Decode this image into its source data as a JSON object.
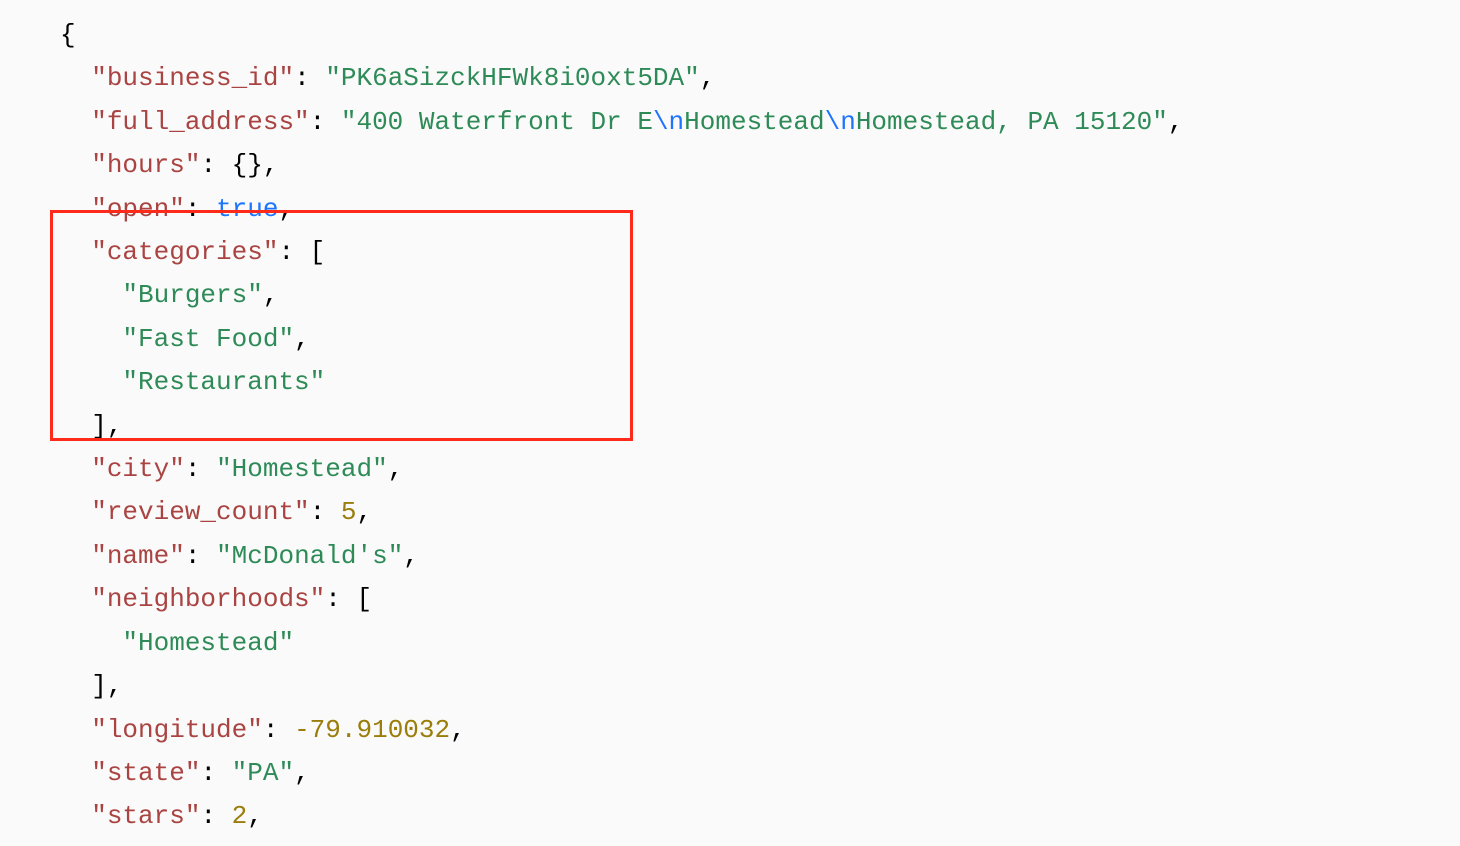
{
  "keys": {
    "business_id": "\"business_id\"",
    "full_address": "\"full_address\"",
    "hours": "\"hours\"",
    "open": "\"open\"",
    "categories": "\"categories\"",
    "city": "\"city\"",
    "review_count": "\"review_count\"",
    "name": "\"name\"",
    "neighborhoods": "\"neighborhoods\"",
    "longitude": "\"longitude\"",
    "state": "\"state\"",
    "stars": "\"stars\""
  },
  "vals": {
    "business_id": "\"PK6aSizckHFWk8i0oxt5DA\"",
    "addr_part1": "\"400 Waterfront Dr E",
    "addr_esc1": "\\n",
    "addr_part2": "Homestead",
    "addr_esc2": "\\n",
    "addr_part3": "Homestead, PA 15120\"",
    "hours": "{}",
    "open": "true",
    "cat1": "\"Burgers\"",
    "cat2": "\"Fast Food\"",
    "cat3": "\"Restaurants\"",
    "city": "\"Homestead\"",
    "review_count": "5",
    "name": "\"McDonald's\"",
    "neighborhood1": "\"Homestead\"",
    "longitude": "-79.910032",
    "state": "\"PA\"",
    "stars": "2"
  },
  "punct": {
    "open_brace": "{",
    "colon_sp": ": ",
    "comma": ",",
    "open_bracket": "[",
    "close_bracket": "]",
    "close_bracket_comma": "],"
  }
}
